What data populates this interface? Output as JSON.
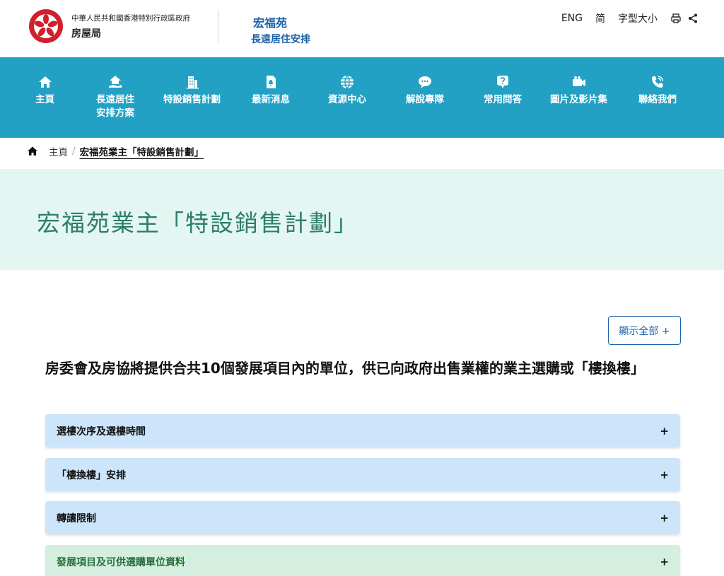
{
  "header": {
    "gov_name": "中華人民共和國香港特別行政區政府",
    "dept_name": "房屋局",
    "site_title": "宏福苑",
    "site_subtitle": "長遠居住安排",
    "lang_eng": "ENG",
    "lang_sc": "简",
    "font_size": "字型大小"
  },
  "nav": {
    "items": [
      {
        "label": "主頁",
        "icon": "home-icon"
      },
      {
        "label": "長遠居住\n安排方案",
        "icon": "house-hand-icon"
      },
      {
        "label": "特設銷售計劃",
        "icon": "building-icon"
      },
      {
        "label": "最新消息",
        "icon": "news-icon"
      },
      {
        "label": "資源中心",
        "icon": "globe-icon"
      },
      {
        "label": "解說專隊",
        "icon": "chat-icon"
      },
      {
        "label": "常用問答",
        "icon": "question-icon"
      },
      {
        "label": "圖片及影片集",
        "icon": "camera-icon"
      },
      {
        "label": "聯絡我們",
        "icon": "phone-icon"
      }
    ]
  },
  "breadcrumb": {
    "home": "主頁",
    "separator": "/",
    "current": "宏福苑業主「特設銷售計劃」"
  },
  "banner": {
    "title": "宏福苑業主「特設銷售計劃」"
  },
  "main": {
    "show_all": "顯示全部 +",
    "headline": "房委會及房協將提供合共10個發展項目內的單位，供已向政府出售業權的業主選購或「樓換樓」",
    "accordion": [
      {
        "label": "選樓次序及選樓時間",
        "toggle": "+"
      },
      {
        "label": "「樓換樓」安排",
        "toggle": "+"
      },
      {
        "label": "轉讓限制",
        "toggle": "+"
      },
      {
        "label": "發展項目及可供選購單位資料",
        "toggle": "+"
      }
    ]
  },
  "colors": {
    "nav_bg": "#22a1c4",
    "banner_bg": "#e4f6f1",
    "banner_text": "#2c7d6c",
    "brand_blue": "#1c62a8",
    "accordion_blue": "#cde5fb",
    "accordion_green": "#d4efdf"
  }
}
